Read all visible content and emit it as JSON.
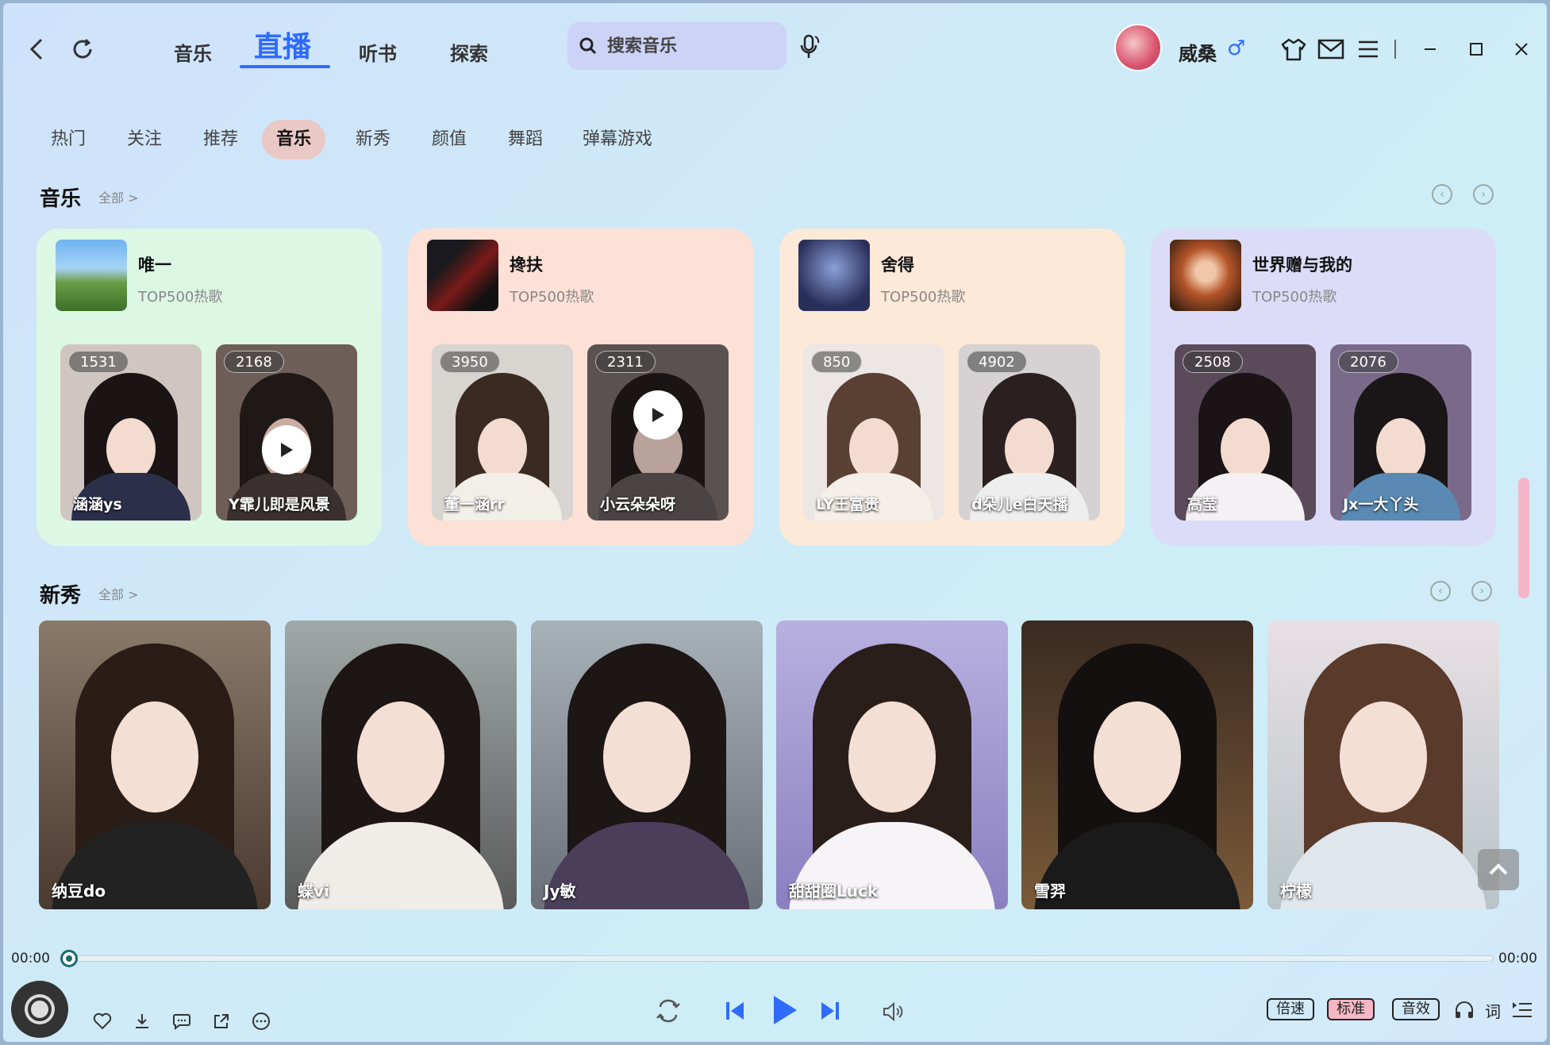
{
  "main_tabs": [
    "音乐",
    "直播",
    "听书",
    "探索"
  ],
  "search": {
    "placeholder": "搜索音乐"
  },
  "user": {
    "name": "威桑",
    "gender_symbol": "♂"
  },
  "categories": [
    "热门",
    "关注",
    "推荐",
    "音乐",
    "新秀",
    "颜值",
    "舞蹈",
    "弹幕游戏"
  ],
  "active_category": "音乐",
  "music_section": {
    "title": "音乐",
    "more": "全部 >",
    "cards": [
      {
        "title": "唯一",
        "subtitle": "TOP500热歌",
        "bg": "#dcf7e4",
        "streams": [
          {
            "count": "1531",
            "name": "涵涵ys"
          },
          {
            "count": "2168",
            "name": "Y霏儿即是风景"
          }
        ]
      },
      {
        "title": "搀扶",
        "subtitle": "TOP500热歌",
        "bg": "#fde0d6",
        "streams": [
          {
            "count": "3950",
            "name": "董一涵rr"
          },
          {
            "count": "2311",
            "name": "小云朵朵呀"
          }
        ]
      },
      {
        "title": "舍得",
        "subtitle": "TOP500热歌",
        "bg": "#fde9d8",
        "streams": [
          {
            "count": "850",
            "name": "LY王富贵"
          },
          {
            "count": "4902",
            "name": "d朵儿e白天播"
          }
        ]
      },
      {
        "title": "世界赠与我的",
        "subtitle": "TOP500热歌",
        "bg": "#dcdcf8",
        "streams": [
          {
            "count": "2508",
            "name": "高莹"
          },
          {
            "count": "2076",
            "name": "Jx一大丫头"
          }
        ]
      }
    ]
  },
  "new_section": {
    "title": "新秀",
    "more": "全部 >",
    "cards": [
      {
        "name": "纳豆do"
      },
      {
        "name": "蝶vi"
      },
      {
        "name": "Jy敏"
      },
      {
        "name": "甜甜圈Luck"
      },
      {
        "name": "雪羿"
      },
      {
        "name": "柠檬"
      }
    ]
  },
  "player": {
    "time_current": "00:00",
    "time_total": "00:00",
    "progress": 0,
    "speed_label": "倍速",
    "quality_label": "标准",
    "effect_label": "音效",
    "lyrics_label": "词"
  },
  "colors": {
    "accent": "#2f6bff",
    "active_category_bg": "#e9c8c6",
    "quality_active_bg": "#f6b7c4"
  }
}
